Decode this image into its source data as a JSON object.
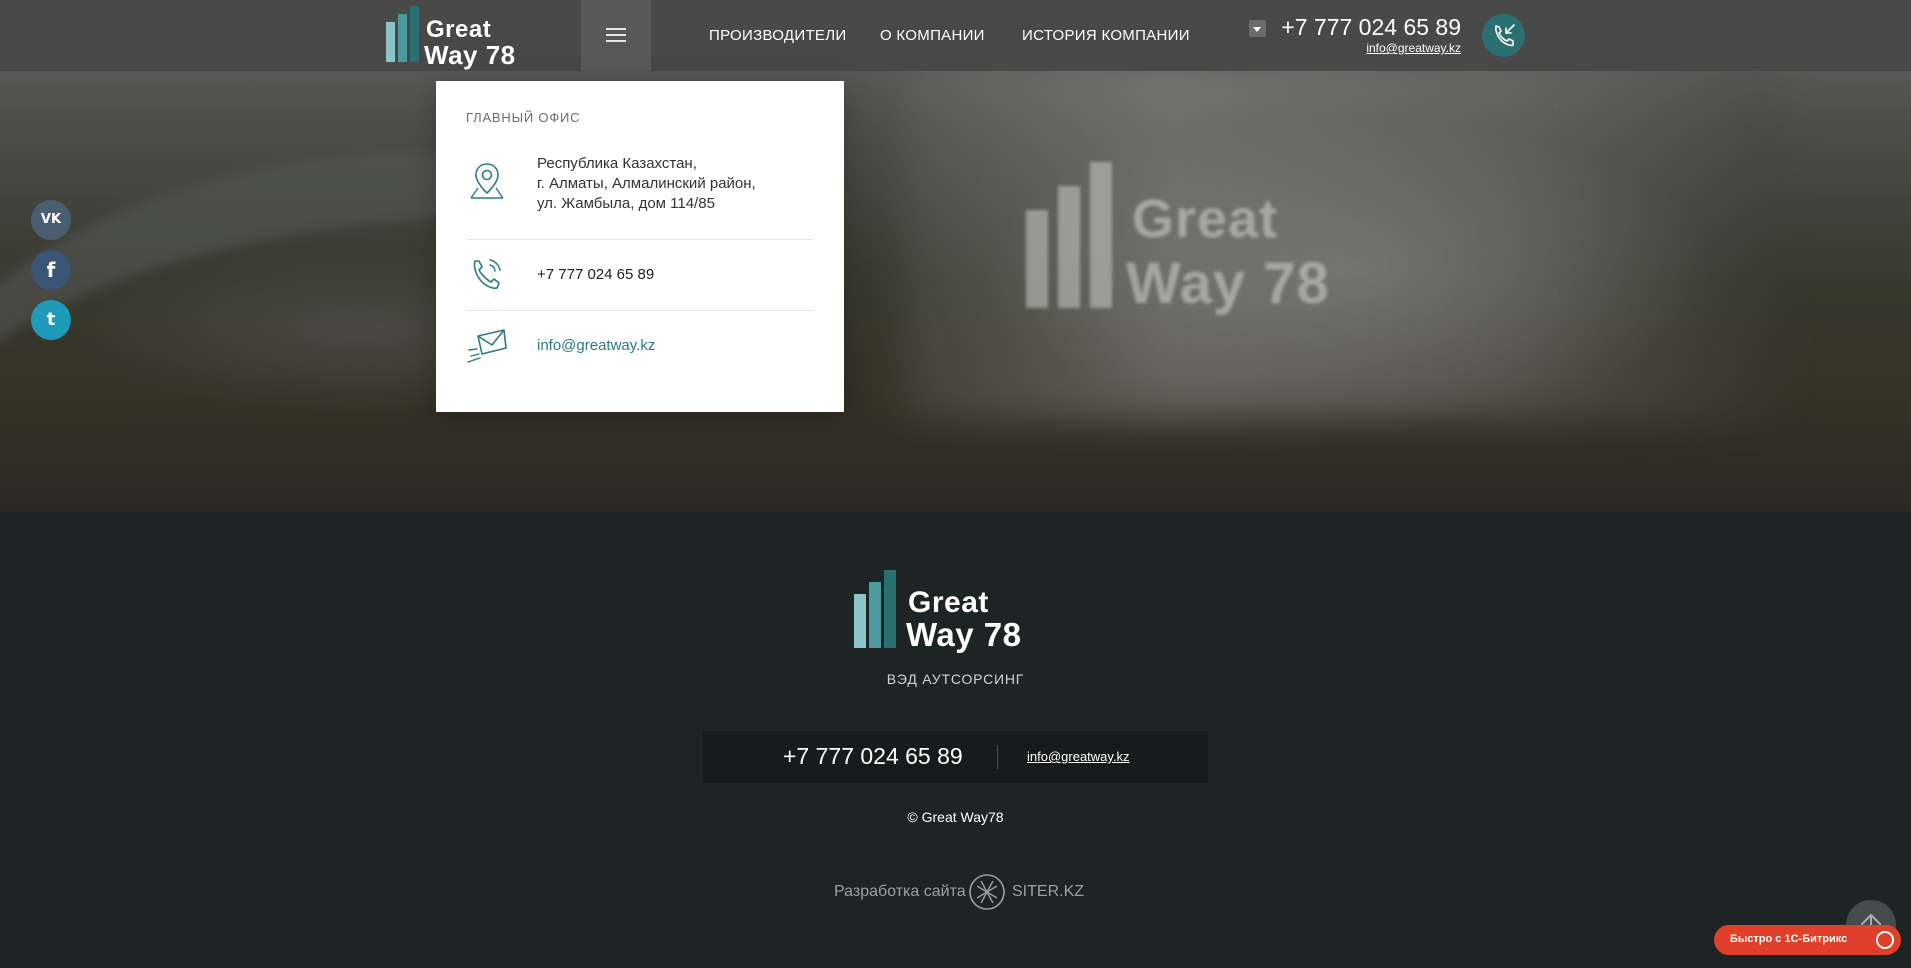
{
  "brand": {
    "logo_line1": "Great",
    "logo_line2": "Way 78",
    "colors": {
      "bar_light": "#8cc3c6",
      "bar_mid": "#4a9a9e",
      "bar_dark": "#2a6f72"
    }
  },
  "header": {
    "nav": [
      {
        "label": "ПРОИЗВОДИТЕЛИ"
      },
      {
        "label": "О КОМПАНИИ"
      },
      {
        "label": "ИСТОРИЯ КОМПАНИИ"
      }
    ],
    "phone": "+7 777 024 65 89",
    "email": "info@greatway.kz",
    "icons": {
      "menu": "hamburger-icon",
      "dropdown": "caret-down-icon",
      "callback": "incoming-call-icon"
    }
  },
  "social": [
    {
      "name": "vk",
      "glyph": "VK",
      "color": "#4a5e72"
    },
    {
      "name": "facebook",
      "glyph": "f",
      "color": "#3b5577"
    },
    {
      "name": "twitter",
      "glyph": "t",
      "color": "#1f9ab8"
    }
  ],
  "dropdown": {
    "title": "ГЛАВНЫЙ ОФИС",
    "address_lines": [
      "Республика Казахстан,",
      "г. Алматы, Алмалинский район,",
      "ул. Жамбыла, дом 114/85"
    ],
    "phone": "+7 777 024 65 89",
    "email": "info@greatway.kz",
    "icon_color": "#2b7b83"
  },
  "hero": {
    "logo_line1": "Great",
    "logo_line2": "Way 78"
  },
  "footer": {
    "logo_line1": "Great",
    "logo_line2": "Way 78",
    "tagline": "ВЭД АУТСОРСИНГ",
    "phone": "+7 777 024 65 89",
    "email": "info@greatway.kz",
    "copyright": "© Great Way78",
    "dev_label": "Разработка сайта",
    "dev_brand": "SITER.KZ"
  },
  "widgets": {
    "bitrix_label": "Быстро с 1С-Битрикс"
  }
}
